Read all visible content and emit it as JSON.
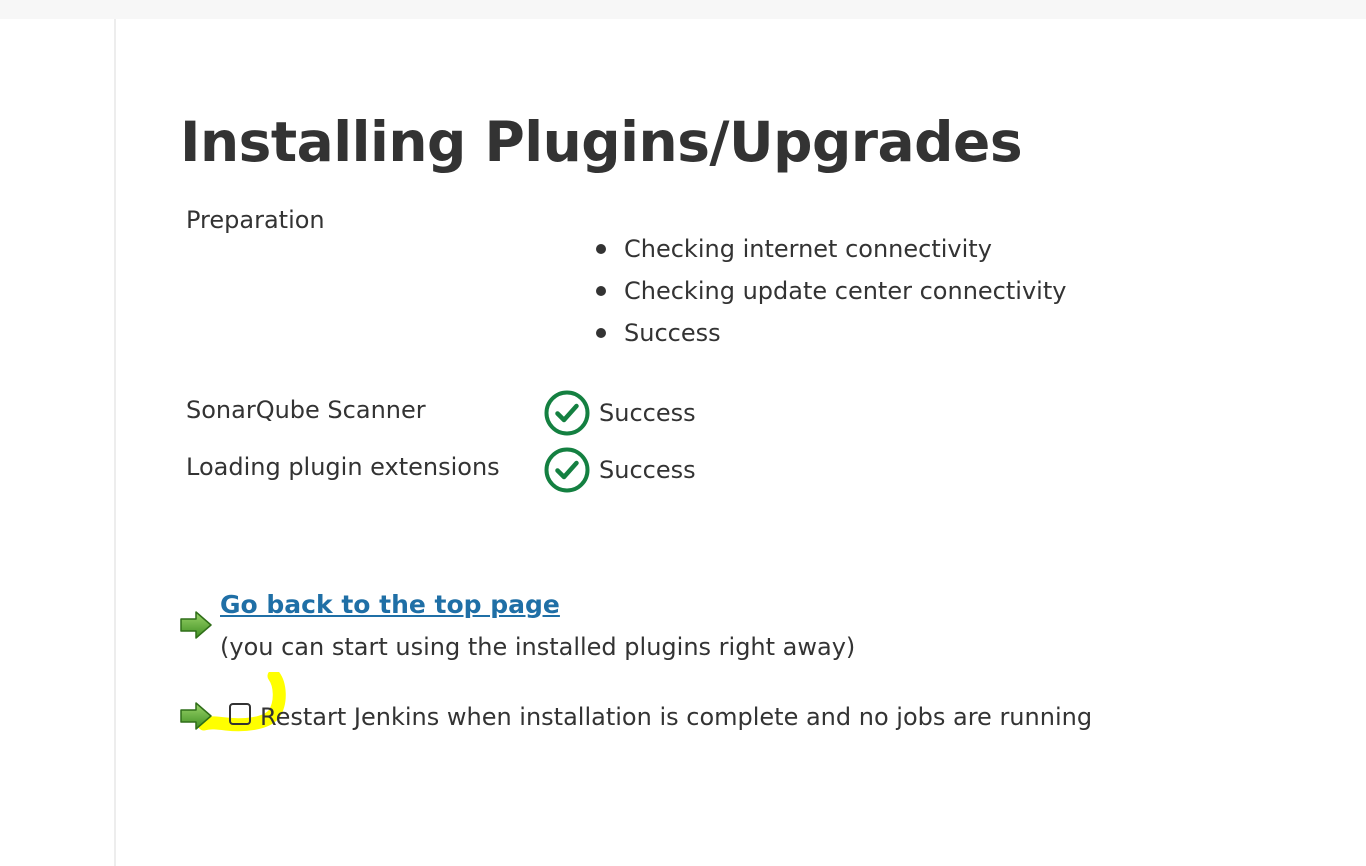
{
  "page": {
    "title": "Installing Plugins/Upgrades"
  },
  "preparation": {
    "label": "Preparation",
    "steps": [
      "Checking internet connectivity",
      "Checking update center connectivity",
      "Success"
    ]
  },
  "plugins": [
    {
      "name": "SonarQube Scanner",
      "status": "Success",
      "status_icon": "check-circle-icon"
    },
    {
      "name": "Loading plugin extensions",
      "status": "Success",
      "status_icon": "check-circle-icon"
    }
  ],
  "actions": {
    "top_page_link": "Go back to the top page",
    "top_page_note": "(you can start using the installed plugins right away)",
    "restart_label": "Restart Jenkins when installation is complete and no jobs are running",
    "restart_checked": false,
    "arrow_icon": "green-arrow-icon"
  },
  "colors": {
    "success": "#148041",
    "link": "#1f6fa6",
    "text": "#333333",
    "arrow": "#5aa532",
    "highlight": "#ffff00"
  }
}
